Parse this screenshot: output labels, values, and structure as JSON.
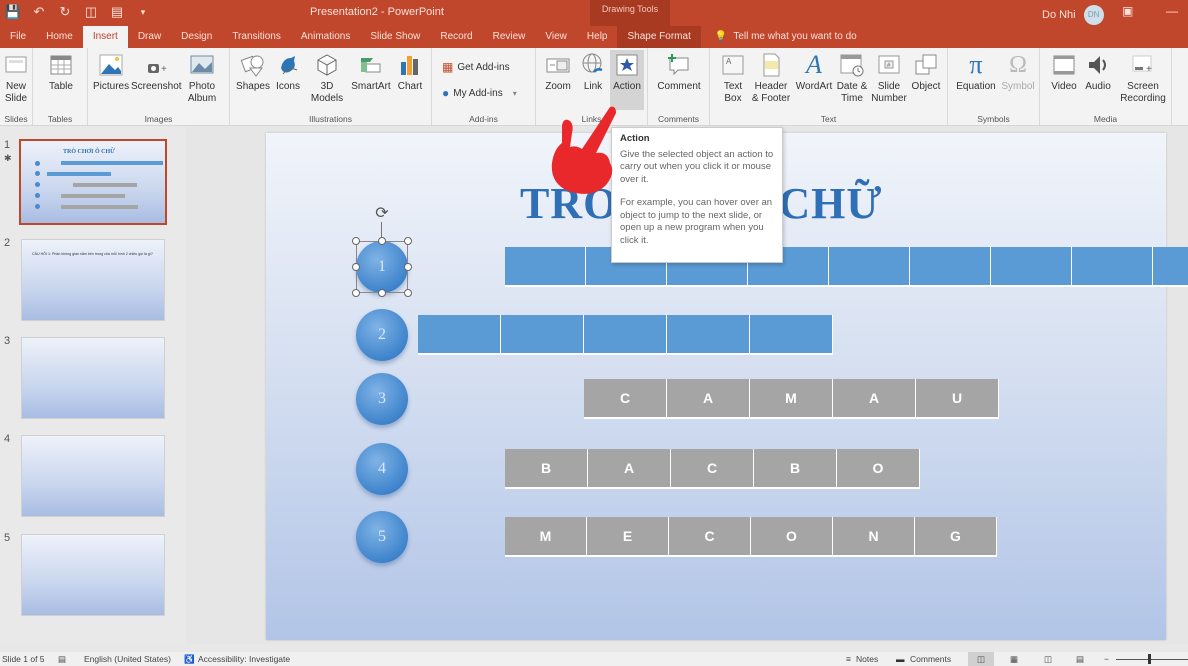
{
  "window": {
    "title": "Presentation2 - PowerPoint",
    "context_tab_group": "Drawing Tools",
    "user_name": "Do Nhi",
    "user_initials": "DN"
  },
  "quick_access": [
    "save-icon",
    "undo-icon",
    "redo-icon",
    "present-icon",
    "layout-icon"
  ],
  "tabs": [
    {
      "label": "File"
    },
    {
      "label": "Home"
    },
    {
      "label": "Insert",
      "active": true
    },
    {
      "label": "Draw"
    },
    {
      "label": "Design"
    },
    {
      "label": "Transitions"
    },
    {
      "label": "Animations"
    },
    {
      "label": "Slide Show"
    },
    {
      "label": "Record"
    },
    {
      "label": "Review"
    },
    {
      "label": "View"
    },
    {
      "label": "Help"
    },
    {
      "label": "Shape Format",
      "contextual": true
    }
  ],
  "tell_me": "Tell me what you want to do",
  "ribbon": {
    "groups": {
      "slides": "Slides",
      "tables": "Tables",
      "images": "Images",
      "illustrations": "Illustrations",
      "addins": "Add-ins",
      "links": "Links",
      "comments": "Comments",
      "text": "Text",
      "symbols": "Symbols",
      "media": "Media"
    },
    "buttons": {
      "new_slide": [
        "New",
        "Slide"
      ],
      "table": [
        "Table",
        ""
      ],
      "pictures": [
        "Pictures",
        ""
      ],
      "screenshot": [
        "Screenshot",
        ""
      ],
      "photo_album": [
        "Photo",
        "Album"
      ],
      "shapes": [
        "Shapes",
        ""
      ],
      "icons": [
        "Icons",
        ""
      ],
      "models3d": [
        "3D",
        "Models"
      ],
      "smartart": [
        "SmartArt",
        ""
      ],
      "chart": [
        "Chart",
        ""
      ],
      "get_addins": "Get Add-ins",
      "my_addins": "My Add-ins",
      "zoom": [
        "Zoom",
        ""
      ],
      "link": [
        "Link",
        ""
      ],
      "action": [
        "Action",
        ""
      ],
      "comment": [
        "Comment",
        ""
      ],
      "text_box": [
        "Text",
        "Box"
      ],
      "header_footer": [
        "Header",
        "& Footer"
      ],
      "wordart": [
        "WordArt",
        ""
      ],
      "date_time": [
        "Date &",
        "Time"
      ],
      "slide_number": [
        "Slide",
        "Number"
      ],
      "object": [
        "Object",
        ""
      ],
      "equation": [
        "Equation",
        ""
      ],
      "symbol": [
        "Symbol",
        ""
      ],
      "video": [
        "Video",
        ""
      ],
      "audio": [
        "Audio",
        ""
      ],
      "screen_recording": [
        "Screen",
        "Recording"
      ]
    }
  },
  "tooltip": {
    "title": "Action",
    "body1": "Give the selected object an action to carry out when you click it or mouse over it.",
    "body2": "For example, you can hover over an object to jump to the next slide, or open up a new program when you click it."
  },
  "slides_panel": [
    {
      "number": "1",
      "selected": true,
      "title": "TRÒ CHƠI Ô CHỮ"
    },
    {
      "number": "2",
      "text": "CÂU HỎI 1: Phần không gian nằm bên trong của mỗi hình 2 chiều gọi là gì?"
    },
    {
      "number": "3"
    },
    {
      "number": "4"
    },
    {
      "number": "5"
    }
  ],
  "slide": {
    "title_left": "TRÒ",
    "title_right": "CHỮ",
    "rows": [
      {
        "number": "1",
        "letters": [
          "",
          "",
          "",
          "",
          "",
          "",
          "",
          "",
          ""
        ],
        "style": "blue"
      },
      {
        "number": "2",
        "letters": [
          "",
          "",
          "",
          "",
          ""
        ],
        "style": "blue"
      },
      {
        "number": "3",
        "letters": [
          "C",
          "A",
          "M",
          "A",
          "U"
        ],
        "style": "gray"
      },
      {
        "number": "4",
        "letters": [
          "B",
          "A",
          "C",
          "B",
          "O"
        ],
        "style": "gray"
      },
      {
        "number": "5",
        "letters": [
          "M",
          "E",
          "C",
          "O",
          "N",
          "G"
        ],
        "style": "gray"
      }
    ]
  },
  "status": {
    "slide_info": "Slide 1 of 5",
    "language": "English (United States)",
    "accessibility": "Accessibility: Investigate",
    "notes": "Notes",
    "comments": "Comments"
  }
}
